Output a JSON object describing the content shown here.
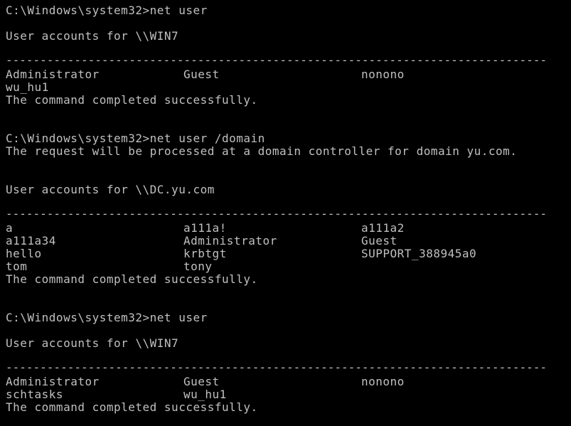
{
  "window": {
    "background": "#000000",
    "text_color": "#c0c0c0"
  },
  "block1": {
    "prompt": "C:\\Windows\\system32>net user",
    "header": "User accounts for \\\\WIN7",
    "rows": [
      [
        "Administrator",
        "Guest",
        "nonono"
      ],
      [
        "wu_hu1",
        "",
        ""
      ]
    ],
    "status": "The command completed successfully."
  },
  "block2": {
    "prompt": "C:\\Windows\\system32>net user /domain",
    "notice": "The request will be processed at a domain controller for domain yu.com.",
    "header": "User accounts for \\\\DC.yu.com",
    "rows": [
      [
        "a",
        "a111a!",
        "a111a2"
      ],
      [
        "a111a34",
        "Administrator",
        "Guest"
      ],
      [
        "hello",
        "krbtgt",
        "SUPPORT_388945a0"
      ],
      [
        "tom",
        "tony",
        ""
      ]
    ],
    "status": "The command completed successfully."
  },
  "block3": {
    "prompt": "C:\\Windows\\system32>net user",
    "header": "User accounts for \\\\WIN7",
    "rows": [
      [
        "Administrator",
        "Guest",
        "nonono"
      ],
      [
        "schtasks",
        "wu_hu1",
        ""
      ]
    ],
    "status": "The command completed successfully."
  },
  "separator": "-------------------------------------------------------------------------------"
}
